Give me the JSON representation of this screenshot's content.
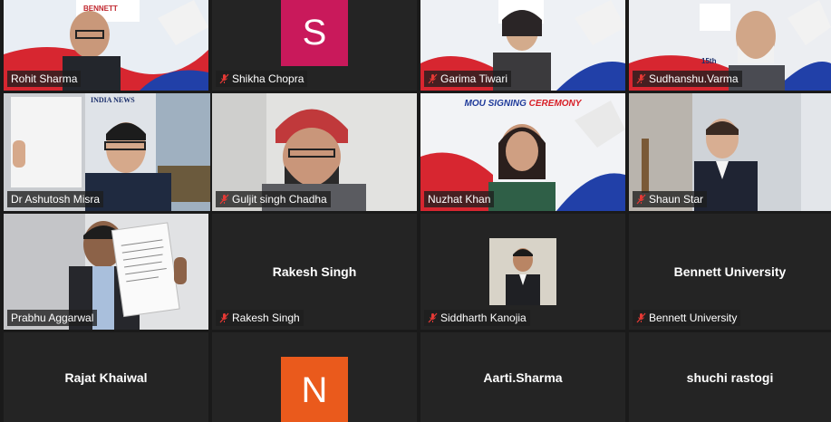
{
  "participants": [
    {
      "name": "Rohit Sharma",
      "muted": false,
      "video": true
    },
    {
      "name": "Shikha Chopra",
      "muted": true,
      "video": false,
      "initial": "S",
      "avatar_color": "#c9195b"
    },
    {
      "name": "Garima Tiwari",
      "muted": true,
      "video": true
    },
    {
      "name": "Sudhanshu.Varma",
      "muted": true,
      "video": true
    },
    {
      "name": "Dr Ashutosh Misra",
      "muted": false,
      "video": true,
      "active_speaker": true
    },
    {
      "name": "Guljit singh Chadha",
      "muted": true,
      "video": true
    },
    {
      "name": "Nuzhat Khan",
      "muted": false,
      "video": true
    },
    {
      "name": "Shaun Star",
      "muted": true,
      "video": true
    },
    {
      "name": "Prabhu Aggarwal",
      "muted": false,
      "video": true
    },
    {
      "name": "Rakesh Singh",
      "display_name": "Rakesh Singh",
      "muted": true,
      "video": false
    },
    {
      "name": "Siddharth Kanojia",
      "muted": true,
      "video": false
    },
    {
      "name": "Bennett University",
      "display_name": "Bennett University",
      "muted": true,
      "video": false
    },
    {
      "name": "Rajat Khaiwal",
      "display_name": "Rajat Khaiwal",
      "video": false
    },
    {
      "name": "N",
      "initial": "N",
      "avatar_color": "#ea5a1c",
      "video": false
    },
    {
      "name": "Aarti.Sharma",
      "display_name": "Aarti.Sharma",
      "video": false
    },
    {
      "name": "shuchi rastogi",
      "display_name": "shuchi rastogi",
      "video": false
    }
  ],
  "banner": {
    "title_part1": "MOU SIGNING",
    "title_part2": "CEREMONY",
    "logo_text": "BENNETT",
    "sign_text": "INDIA NEWS",
    "number_fragment": "15th"
  },
  "colors": {
    "active_border": "#c9e35a",
    "mute_red": "#e53935",
    "tile_bg": "#242424"
  }
}
